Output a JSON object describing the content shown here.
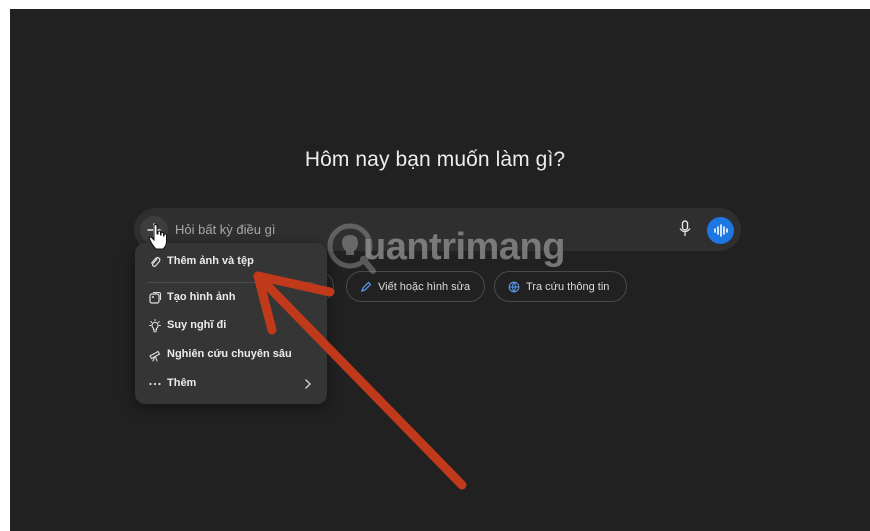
{
  "heading": "Hôm nay bạn muốn làm gì?",
  "composer": {
    "placeholder": "Hỏi bất kỳ điều gì"
  },
  "chips": [
    {
      "label": "Viết hoặc hình sửa",
      "icon": "pencil-icon"
    },
    {
      "label": "Tra cứu thông tin",
      "icon": "globe-icon"
    }
  ],
  "menu": {
    "items": [
      {
        "label": "Thêm ảnh và tệp",
        "icon": "paperclip-icon"
      },
      {
        "label": "Tạo hình ảnh",
        "icon": "image-icon"
      },
      {
        "label": "Suy nghĩ đi",
        "icon": "lightbulb-icon"
      },
      {
        "label": "Nghiên cứu chuyên sâu",
        "icon": "telescope-icon"
      },
      {
        "label": "Thêm",
        "icon": "more-dots-icon"
      }
    ]
  },
  "watermark": {
    "text": "uantrimang"
  },
  "colors": {
    "background": "#212121",
    "composer": "#2f2f2f",
    "menu": "#353535",
    "accent": "#1d77e3",
    "annotation_arrow": "#c0391b"
  }
}
